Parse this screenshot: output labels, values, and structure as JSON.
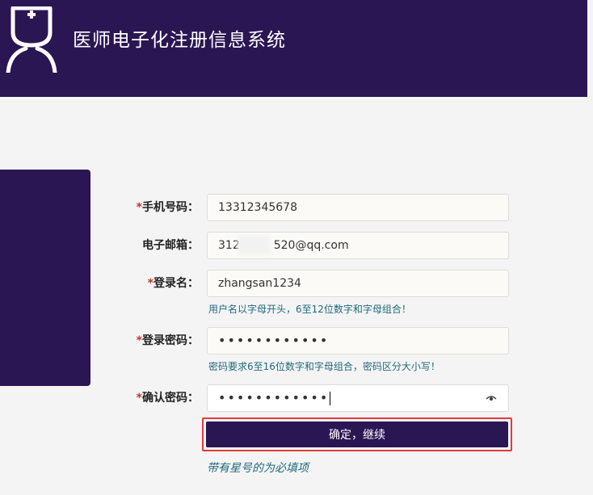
{
  "app": {
    "title": "医师电子化注册信息系统",
    "icon": "doctor-icon"
  },
  "colors": {
    "header_bg": "#2b1654",
    "required_star": "#c0392b",
    "hint_text": "#1f6a7c",
    "highlight_border": "#e53a3a"
  },
  "form": {
    "phone": {
      "star": "*",
      "label": "手机号码：",
      "value": "13312345678"
    },
    "email": {
      "label": "电子邮箱：",
      "value_start": "312",
      "value_end": "520@qq.com"
    },
    "username": {
      "star": "*",
      "label": "登录名：",
      "value": "zhangsan1234",
      "hint": "用户名以字母开头，6至12位数字和字母组合！"
    },
    "password": {
      "star": "*",
      "label": "登录密码：",
      "value": "••••••••••••",
      "hint": "密码要求6至16位数字和字母组合，密码区分大小写！"
    },
    "confirm_password": {
      "star": "*",
      "label": "确认密码：",
      "value": "••••••••••••",
      "icon": "eye-icon"
    },
    "submit_label": "确定，继续",
    "required_note": "带有星号的为必填项"
  }
}
